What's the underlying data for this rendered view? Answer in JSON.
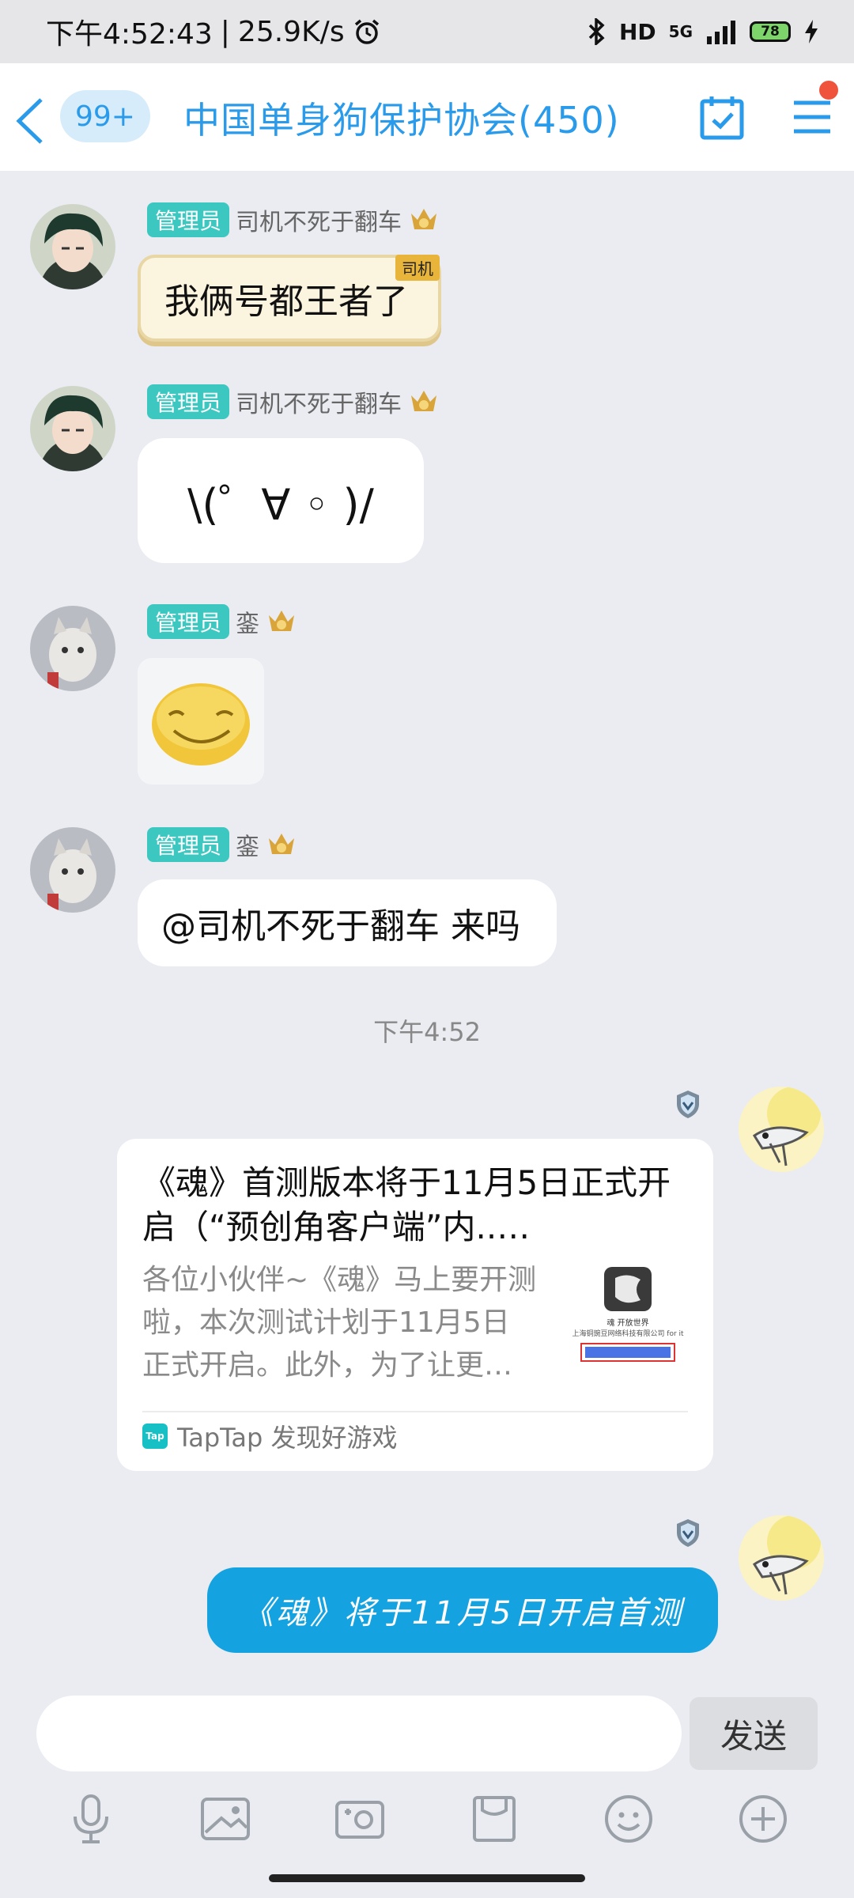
{
  "status_bar": {
    "time": "下午4:52:43",
    "network_speed": "25.9K/s",
    "signal_label": "5G",
    "hd_label": "HD",
    "battery_level": "78"
  },
  "header": {
    "unread_count": "99+",
    "group_title": "中国单身狗保护协会(450)"
  },
  "messages": [
    {
      "role": "管理员",
      "sender": "司机不死于翻车",
      "text": "我俩号都王者了",
      "tag": "司机"
    },
    {
      "role": "管理员",
      "sender": "司机不死于翻车",
      "text": "\\(゜∀ ◦ )/"
    },
    {
      "role": "管理员",
      "sender": "銮",
      "sticker": "smiley-sticker"
    },
    {
      "role": "管理员",
      "sender": "銮",
      "text": "@司机不死于翻车 来吗"
    }
  ],
  "time_separator": "下午4:52",
  "share_card": {
    "title": "《魂》首测版本将于11月5日正式开启（“预创角客户端”内..…",
    "description": "各位小伙伴~《魂》马上要开测啦，本次测试计划于11月5日正式开启。此外，为了让更…",
    "thumb_caption": "魂 开放世界",
    "thumb_company": "上海铜豌豆网络科技有限公司 for it",
    "source": "TapTap 发现好游戏",
    "source_logo": "Tap"
  },
  "sent_message": "《魂》将于11月5日开启首测",
  "composer": {
    "input_value": "",
    "send_label": "发送"
  },
  "toolbar": [
    "microphone-icon",
    "image-icon",
    "camera-icon",
    "file-icon",
    "emoji-icon",
    "plus-icon"
  ],
  "colors": {
    "accent": "#2a9bea",
    "admin_tag": "#3cc8c0",
    "sent_bubble": "#14a3e0",
    "background": "#eaecf1"
  }
}
